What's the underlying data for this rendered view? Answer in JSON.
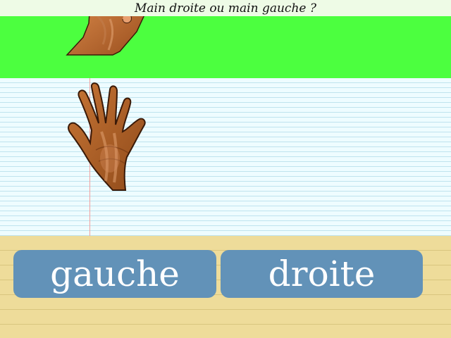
{
  "question": "Main droite ou main gauche ?",
  "buttons": {
    "left_label": "gauche",
    "right_label": "droite"
  },
  "colors": {
    "title_bg": "#eefbe6",
    "green_band": "#4cff3f",
    "paper_bg": "#eefcff",
    "paper_lines": "#bfe3ee",
    "margin_line": "#f2a0a0",
    "bottom_bg": "#eedc9a",
    "button_bg": "#6292b8",
    "skin": "#b8652a"
  },
  "icons": {
    "top_hand": "hand-icon",
    "main_hand": "hand-icon"
  }
}
